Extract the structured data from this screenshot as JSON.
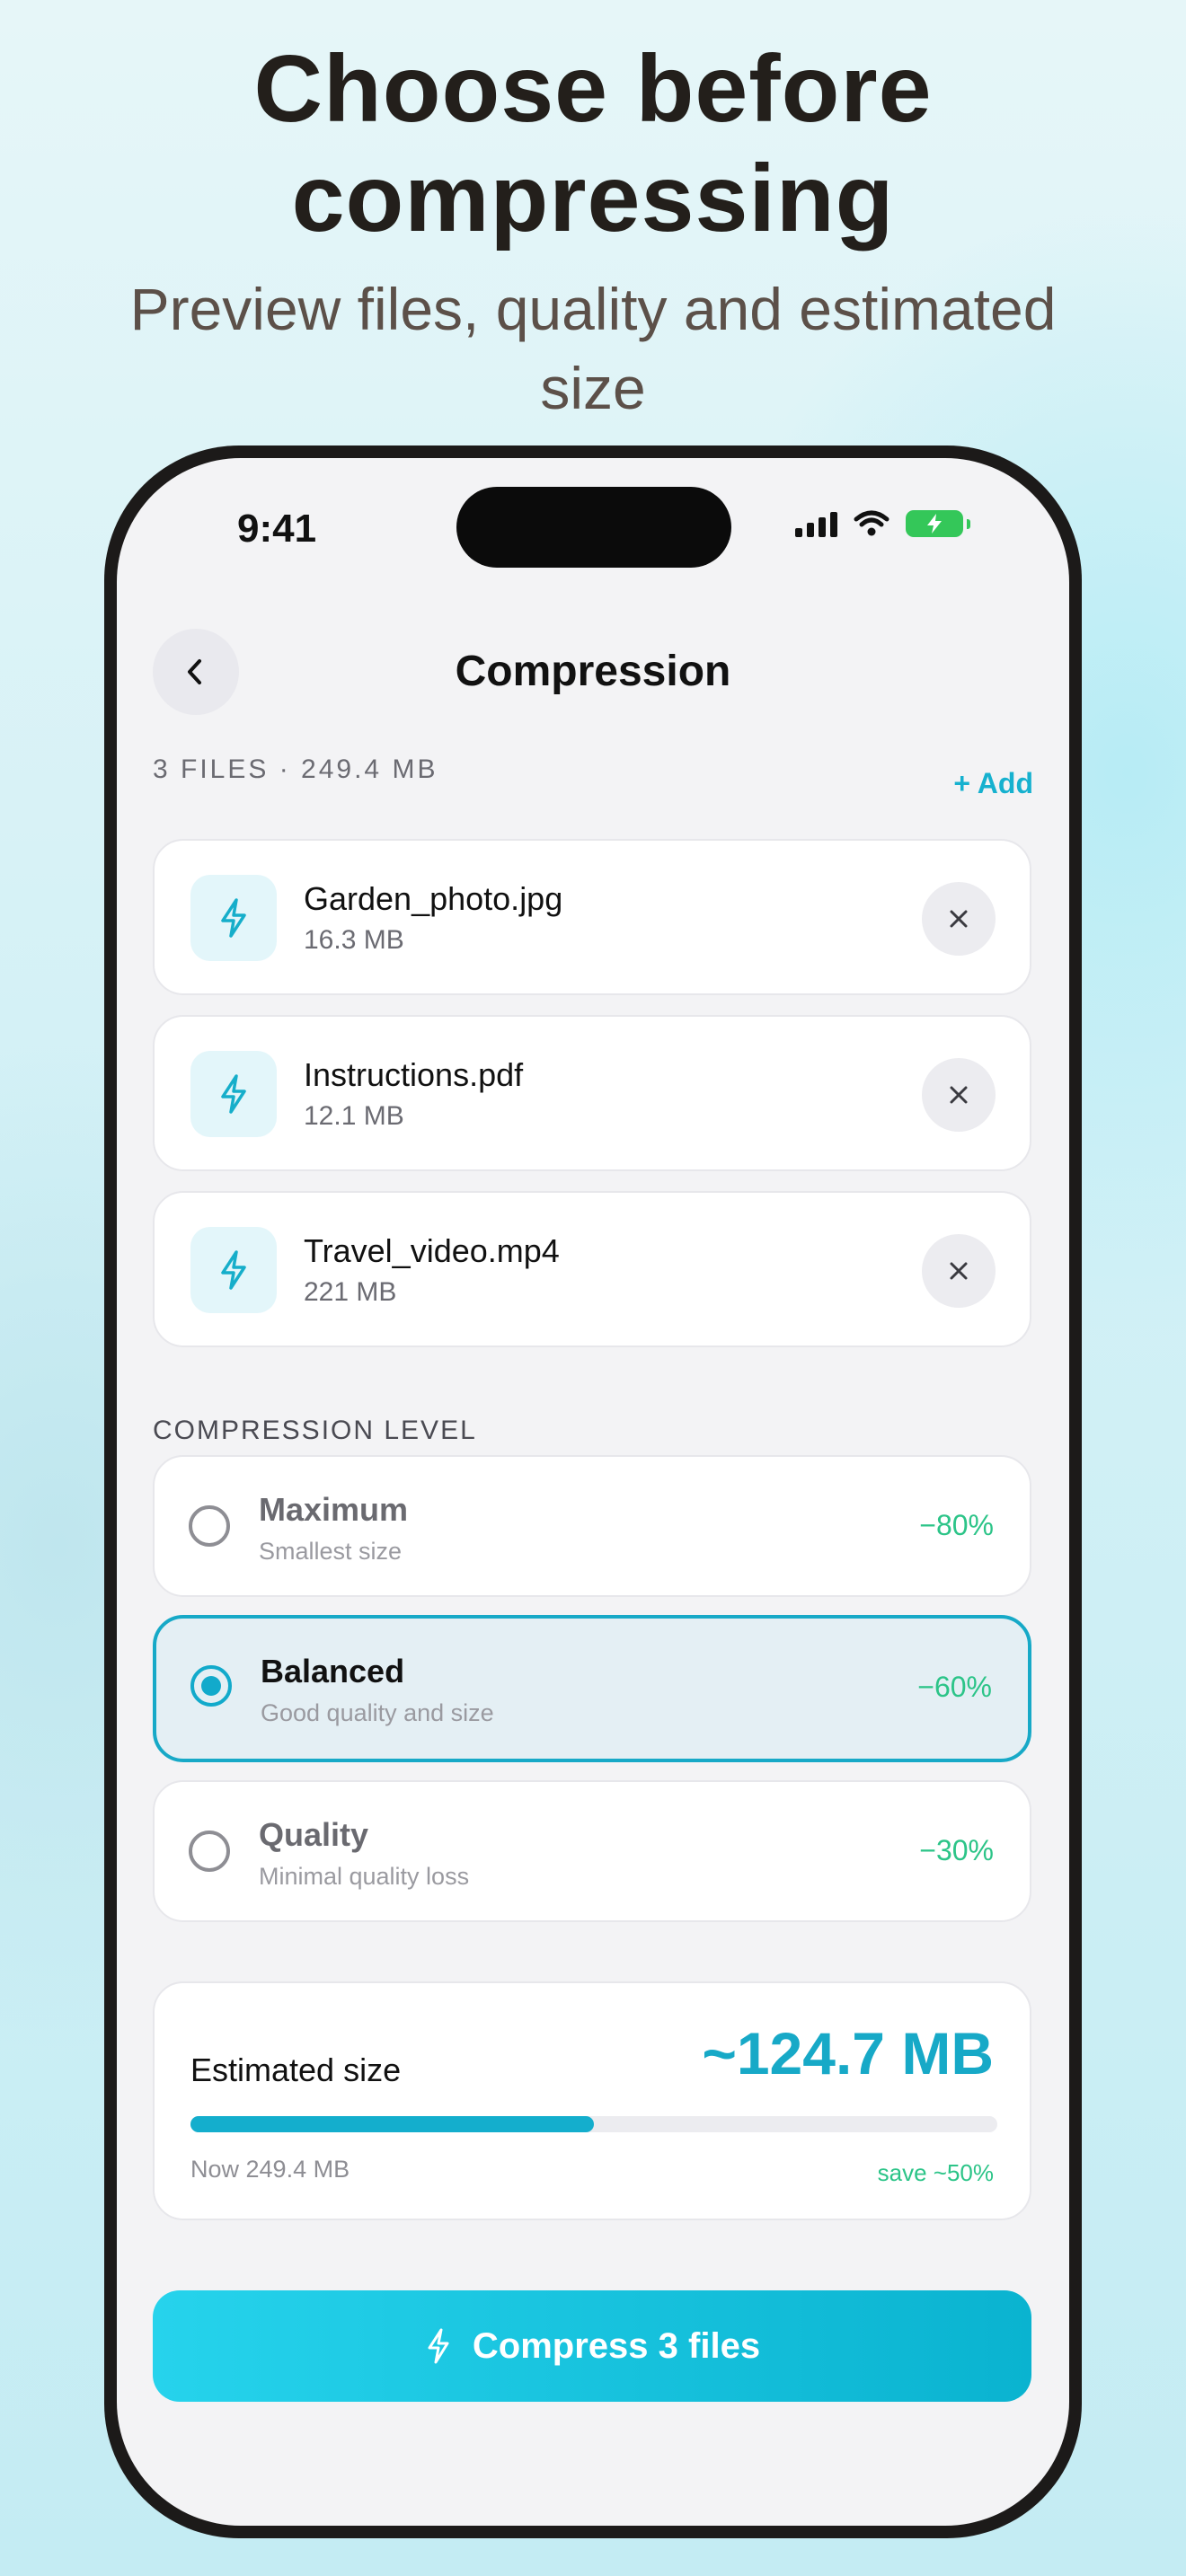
{
  "headline": "Choose before compressing",
  "subheadline": "Preview files, quality and estimated size",
  "status_bar": {
    "time": "9:41"
  },
  "nav": {
    "title": "Compression"
  },
  "files_header": {
    "count_label": "3 FILES · 249.4 MB",
    "add_label": "+ Add"
  },
  "files": [
    {
      "name": "Garden_photo.jpg",
      "size": "16.3 MB"
    },
    {
      "name": "Instructions.pdf",
      "size": "12.1 MB"
    },
    {
      "name": "Travel_video.mp4",
      "size": "221 MB"
    }
  ],
  "compression_level": {
    "label": "COMPRESSION LEVEL",
    "selected": "Balanced",
    "options": [
      {
        "name": "Maximum",
        "description": "Smallest size",
        "reduction": "−80%"
      },
      {
        "name": "Balanced",
        "description": "Good quality and size",
        "reduction": "−60%"
      },
      {
        "name": "Quality",
        "description": "Minimal quality loss",
        "reduction": "−30%"
      }
    ]
  },
  "estimate": {
    "label": "Estimated size",
    "value": "~124.7 MB",
    "now": "Now 249.4 MB",
    "save": "save ~50%",
    "progress_fraction": 0.5
  },
  "cta": {
    "label": "Compress 3 files"
  },
  "colors": {
    "accent": "#17a9c7",
    "positive": "#2cc488",
    "battery": "#34c759"
  }
}
